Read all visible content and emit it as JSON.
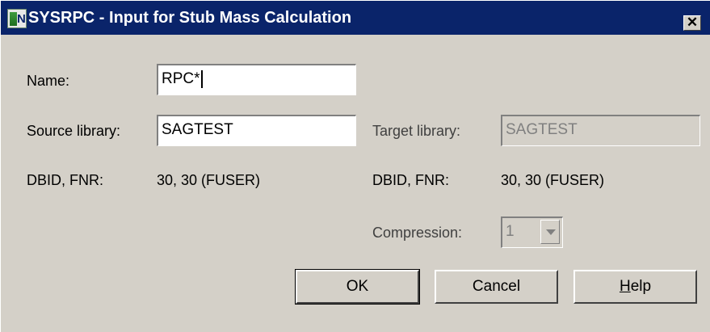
{
  "window": {
    "title": "SYSRPC - Input for Stub Mass Calculation",
    "close_glyph": "✕"
  },
  "icons": {
    "app": "natural-app-icon",
    "close": "close-icon",
    "dropdown": "chevron-down-icon"
  },
  "form": {
    "name_label": "Name:",
    "name_value": "RPC*",
    "source_label": "Source library:",
    "source_value": "SAGTEST",
    "source_dbid_label": "DBID, FNR:",
    "source_dbid_value": "30, 30  (FUSER)",
    "target_label": "Target library:",
    "target_value": "SAGTEST",
    "target_dbid_label": "DBID, FNR:",
    "target_dbid_value": "30, 30  (FUSER)",
    "compression_label": "Compression:",
    "compression_value": "1"
  },
  "buttons": {
    "ok": "OK",
    "cancel": "Cancel",
    "help_first": "H",
    "help_rest": "elp"
  },
  "colors": {
    "title_bar": "#0a246a",
    "dialog_bg": "#d4d0c8",
    "disabled_text": "#808080"
  }
}
